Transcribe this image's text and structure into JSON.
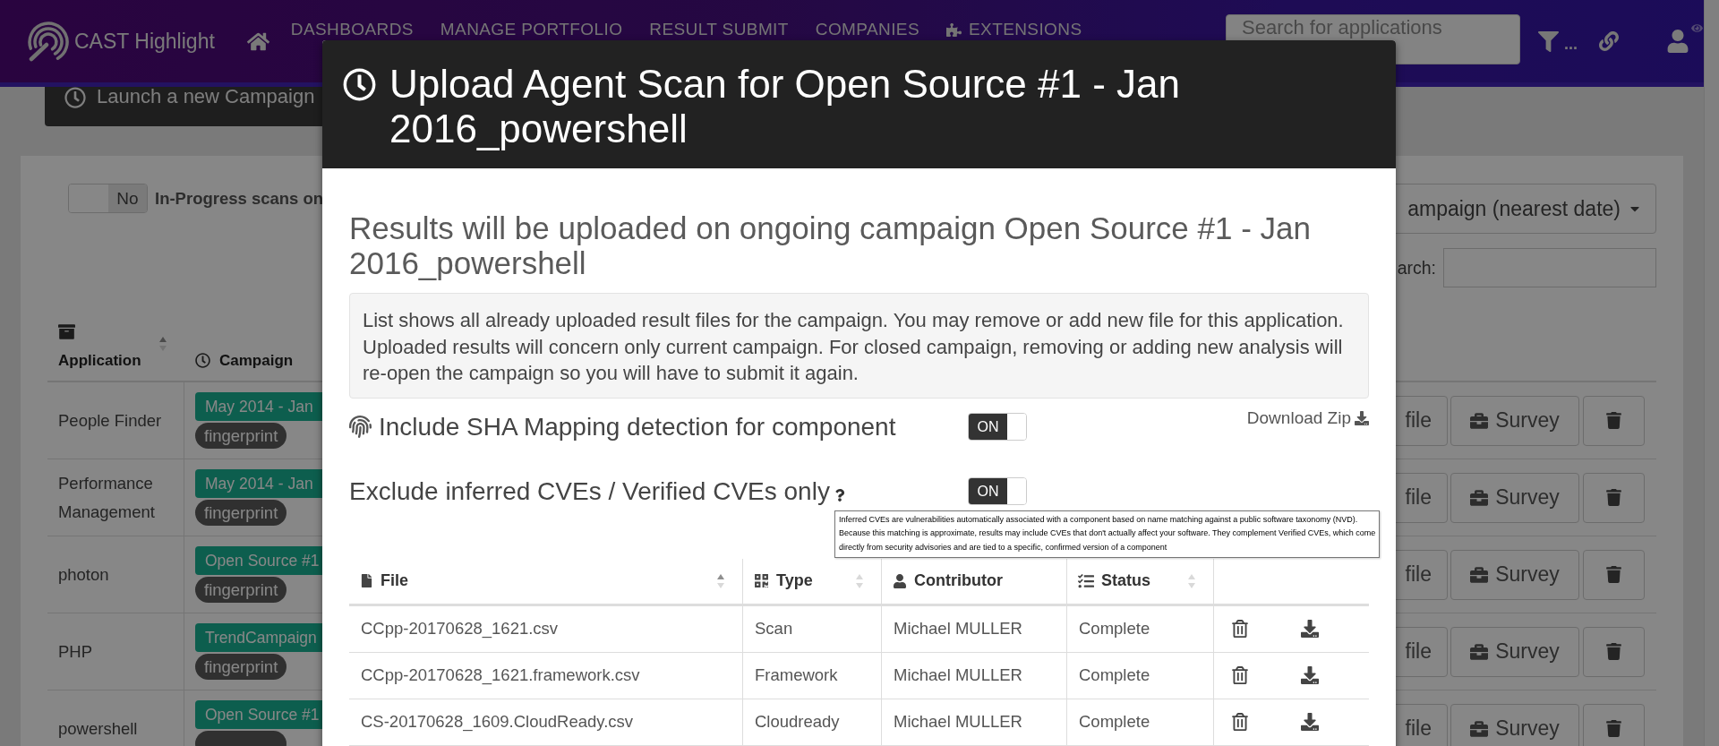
{
  "navbar": {
    "brand": "CAST Highlight",
    "items": [
      {
        "label": "DASHBOARDS",
        "kind": "plain"
      },
      {
        "label": "MANAGE PORTFOLIO",
        "kind": "plain"
      },
      {
        "label": "RESULT SUBMIT",
        "kind": "plain"
      },
      {
        "label": "COMPANIES",
        "kind": "plain"
      },
      {
        "label": "EXTENSIONS",
        "kind": "with-icon"
      }
    ],
    "search": {
      "placeholder": "Search for applications"
    },
    "filter_more": "..."
  },
  "launch_button": {
    "label": "Launch a new Campaign"
  },
  "filters": {
    "in_progress_toggle": {
      "label": "No",
      "on": false
    },
    "in_progress_caption": "In-Progress scans on",
    "sort_dropdown": {
      "label": "ampaign (nearest date)"
    },
    "search": {
      "label": "arch:"
    }
  },
  "applications": {
    "columns": [
      {
        "label": "Application",
        "kind": "archive",
        "sorted": true
      },
      {
        "label": "Campaign",
        "kind": "clock"
      }
    ],
    "rows": [
      {
        "name": "People Finder",
        "campaign": "May 2014 - Jan",
        "tag": "fingerprint",
        "upload_action": "file",
        "survey_action": "Survey"
      },
      {
        "name": "Performance Management",
        "campaign": "May 2014 - Jan",
        "tag": "fingerprint",
        "upload_action": "file",
        "survey_action": "Survey"
      },
      {
        "name": "photon",
        "campaign": "Open Source #1",
        "tag": "fingerprint",
        "upload_action": "file",
        "survey_action": "Survey"
      },
      {
        "name": "PHP",
        "campaign": "TrendCampaign",
        "tag": "fingerprint",
        "upload_action": "file",
        "survey_action": "Survey"
      },
      {
        "name": "powershell",
        "campaign": "Open Source #1",
        "upload_action": "file",
        "survey_action": "Survey"
      }
    ]
  },
  "modal": {
    "title": "Upload Agent Scan for Open Source #1 - Jan 2016_powershell",
    "subtitle": "Results will be uploaded on ongoing campaign Open Source #1 - Jan 2016_powershell",
    "notice_lines": [
      "List shows all already uploaded result files for the campaign. You may remove or add new file for this application.",
      "Uploaded results will concern only current campaign. For closed campaign, removing or adding new analysis will",
      "re-open the campaign so you will have to submit it again."
    ],
    "download_link": "Download Zip",
    "options": [
      {
        "label": "Include SHA Mapping detection for component",
        "kind": "fingerprint",
        "toggle": {
          "label": "ON",
          "on": true
        }
      },
      {
        "label": "Exclude inferred CVEs / Verified CVEs only",
        "kind": "help",
        "toggle": {
          "label": "ON",
          "on": true
        }
      }
    ],
    "tooltip_lines": [
      "Inferred CVEs are vulnerabilities automatically associated with a component based on name matching against a public software taxonomy (NVD).",
      "Because this matching is approximate, results may include CVEs that don't actually affect your software. They complement Verified CVEs, which come",
      "directly from security advisories and are tied to a specific, confirmed version of a component"
    ],
    "table": {
      "columns": [
        {
          "label": "File",
          "kind": "file",
          "sorted": true
        },
        {
          "label": "Type",
          "kind": "type",
          "sorted": false
        },
        {
          "label": "Contributor",
          "kind": "user"
        },
        {
          "label": "Status",
          "kind": "status",
          "sorted": false
        },
        {
          "kind": "actions"
        }
      ],
      "rows": [
        {
          "file": "CCpp-20170628_1621.csv",
          "type": "Scan",
          "contributor": "Michael MULLER",
          "status": "Complete"
        },
        {
          "file": "CCpp-20170628_1621.framework.csv",
          "type": "Framework",
          "contributor": "Michael MULLER",
          "status": "Complete"
        },
        {
          "file": "CS-20170628_1609.CloudReady.csv",
          "type": "Cloudready",
          "contributor": "Michael MULLER",
          "status": "Complete"
        }
      ]
    }
  }
}
